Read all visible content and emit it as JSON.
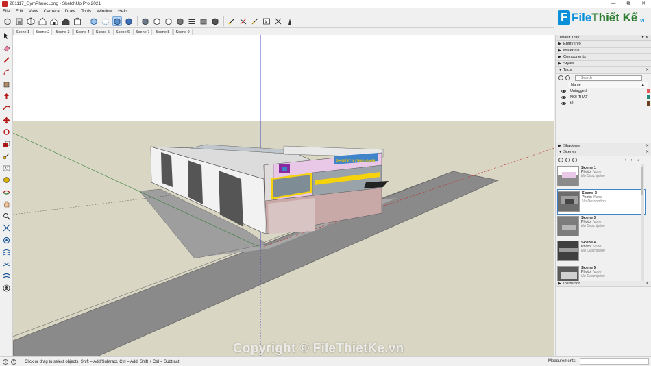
{
  "window": {
    "title": "201117_GymPhuocLong - SketchUp Pro 2021",
    "controls": [
      "—",
      "⧉",
      "✕"
    ]
  },
  "menu": [
    "File",
    "Edit",
    "View",
    "Camera",
    "Draw",
    "Tools",
    "Window",
    "Help"
  ],
  "toolbar": {
    "icons": [
      "select-icon",
      "eraser-icon",
      "line-icon",
      "arc-icon",
      "rectangle-icon",
      "push-pull-icon",
      "move-icon",
      "rotate-icon",
      "scale-icon",
      "offset-icon",
      "tape-measure-icon",
      "text-icon",
      "axes-icon",
      "dimension-icon",
      "paint-bucket-icon",
      "orbit-icon",
      "pan-icon",
      "zoom-icon",
      "zoom-extents-icon",
      "views-icon"
    ],
    "active_index": 8
  },
  "scene_tabs": {
    "labels": [
      "Scene 1",
      "Scene 2",
      "Scene 3",
      "Scene 4",
      "Scene 5",
      "Scene 6",
      "Scene 7",
      "Scene 8",
      "Scene 9"
    ],
    "active": "Scene 2"
  },
  "logo": {
    "mark": "F",
    "brand_a": "File",
    "brand_b": "Thiết Kế",
    "domain": ".vn"
  },
  "watermark": "Copyright © FileThietKe.vn",
  "building": {
    "sign": "PHƯỚC LONG GYM"
  },
  "tray": {
    "title": "Default Tray",
    "controls": "▾ ✕",
    "sections": {
      "entity_info": "Entity Info",
      "materials": "Materials",
      "components": "Components",
      "styles": "Styles",
      "tags": "Tags",
      "shadows": "Shadows",
      "scenes": "Scenes",
      "instructor": "Instructor"
    },
    "tags": {
      "search_placeholder": "Search",
      "column": "Name",
      "rows": [
        {
          "name": "Untagged",
          "color": "#e05a5a"
        },
        {
          "name": "NOI-THAT",
          "color": "#1f8a7a"
        },
        {
          "name": "t2",
          "color": "#6b3f1c"
        }
      ]
    },
    "scenes": {
      "tool_right": "f ↑ ↓ ⋯",
      "items": [
        {
          "name": "Scene 1",
          "photo_label": "Photo:",
          "photo": "None",
          "desc": "No Description"
        },
        {
          "name": "Scene 2",
          "photo_label": "Photo:",
          "photo": "None",
          "desc": "No Description"
        },
        {
          "name": "Scene 3",
          "photo_label": "Photo:",
          "photo": "None",
          "desc": "No Description"
        },
        {
          "name": "Scene 4",
          "photo_label": "Photo:",
          "photo": "None",
          "desc": "No Description"
        },
        {
          "name": "Scene 5",
          "photo_label": "Photo:",
          "photo": "None",
          "desc": "No Description"
        }
      ],
      "selected": "Scene 2"
    }
  },
  "status": {
    "message": "Click or drag to select objects. Shift = Add/Subtract. Ctrl = Add. Shift + Ctrl = Subtract.",
    "measurements_label": "Measurements",
    "measurements_value": ""
  },
  "colors": {
    "sky": "#ffffff",
    "ground": "#d9d6c3",
    "road": "#8e8e8e",
    "facade_pink": "#e8c8e6",
    "accent_blue": "#3f84c8",
    "axis_blue": "#2020c0"
  }
}
